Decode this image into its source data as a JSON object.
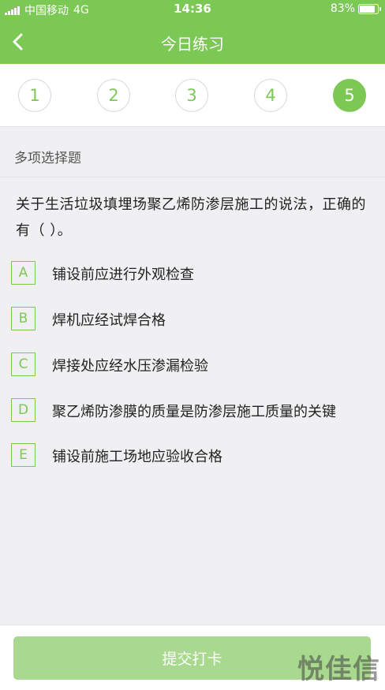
{
  "status_bar": {
    "carrier": "中国移动",
    "network": "4G",
    "time": "14:36",
    "battery": "83%"
  },
  "header": {
    "title": "今日练习",
    "back_icon": "chevron-left-icon",
    "background": "#7cc855"
  },
  "steps": {
    "items": [
      "1",
      "2",
      "3",
      "4",
      "5"
    ],
    "active": "5"
  },
  "question": {
    "type_label": "多项选择题",
    "text": "关于生活垃圾填埋场聚乙烯防渗层施工的说法，正确的有（   ）。",
    "options": [
      {
        "letter": "A",
        "text": "铺设前应进行外观检查"
      },
      {
        "letter": "B",
        "text": "焊机应经试焊合格"
      },
      {
        "letter": "C",
        "text": "焊接处应经水压渗漏检验"
      },
      {
        "letter": "D",
        "text": "聚乙烯防渗膜的质量是防渗层施工质量的关键"
      },
      {
        "letter": "E",
        "text": "铺设前施工场地应验收合格"
      }
    ]
  },
  "footer": {
    "submit_label": "提交打卡"
  },
  "watermark": "悦佳信",
  "colors": {
    "accent": "#7cc855",
    "submit_disabled": "#a9d98e",
    "background": "#f0f0f2"
  }
}
